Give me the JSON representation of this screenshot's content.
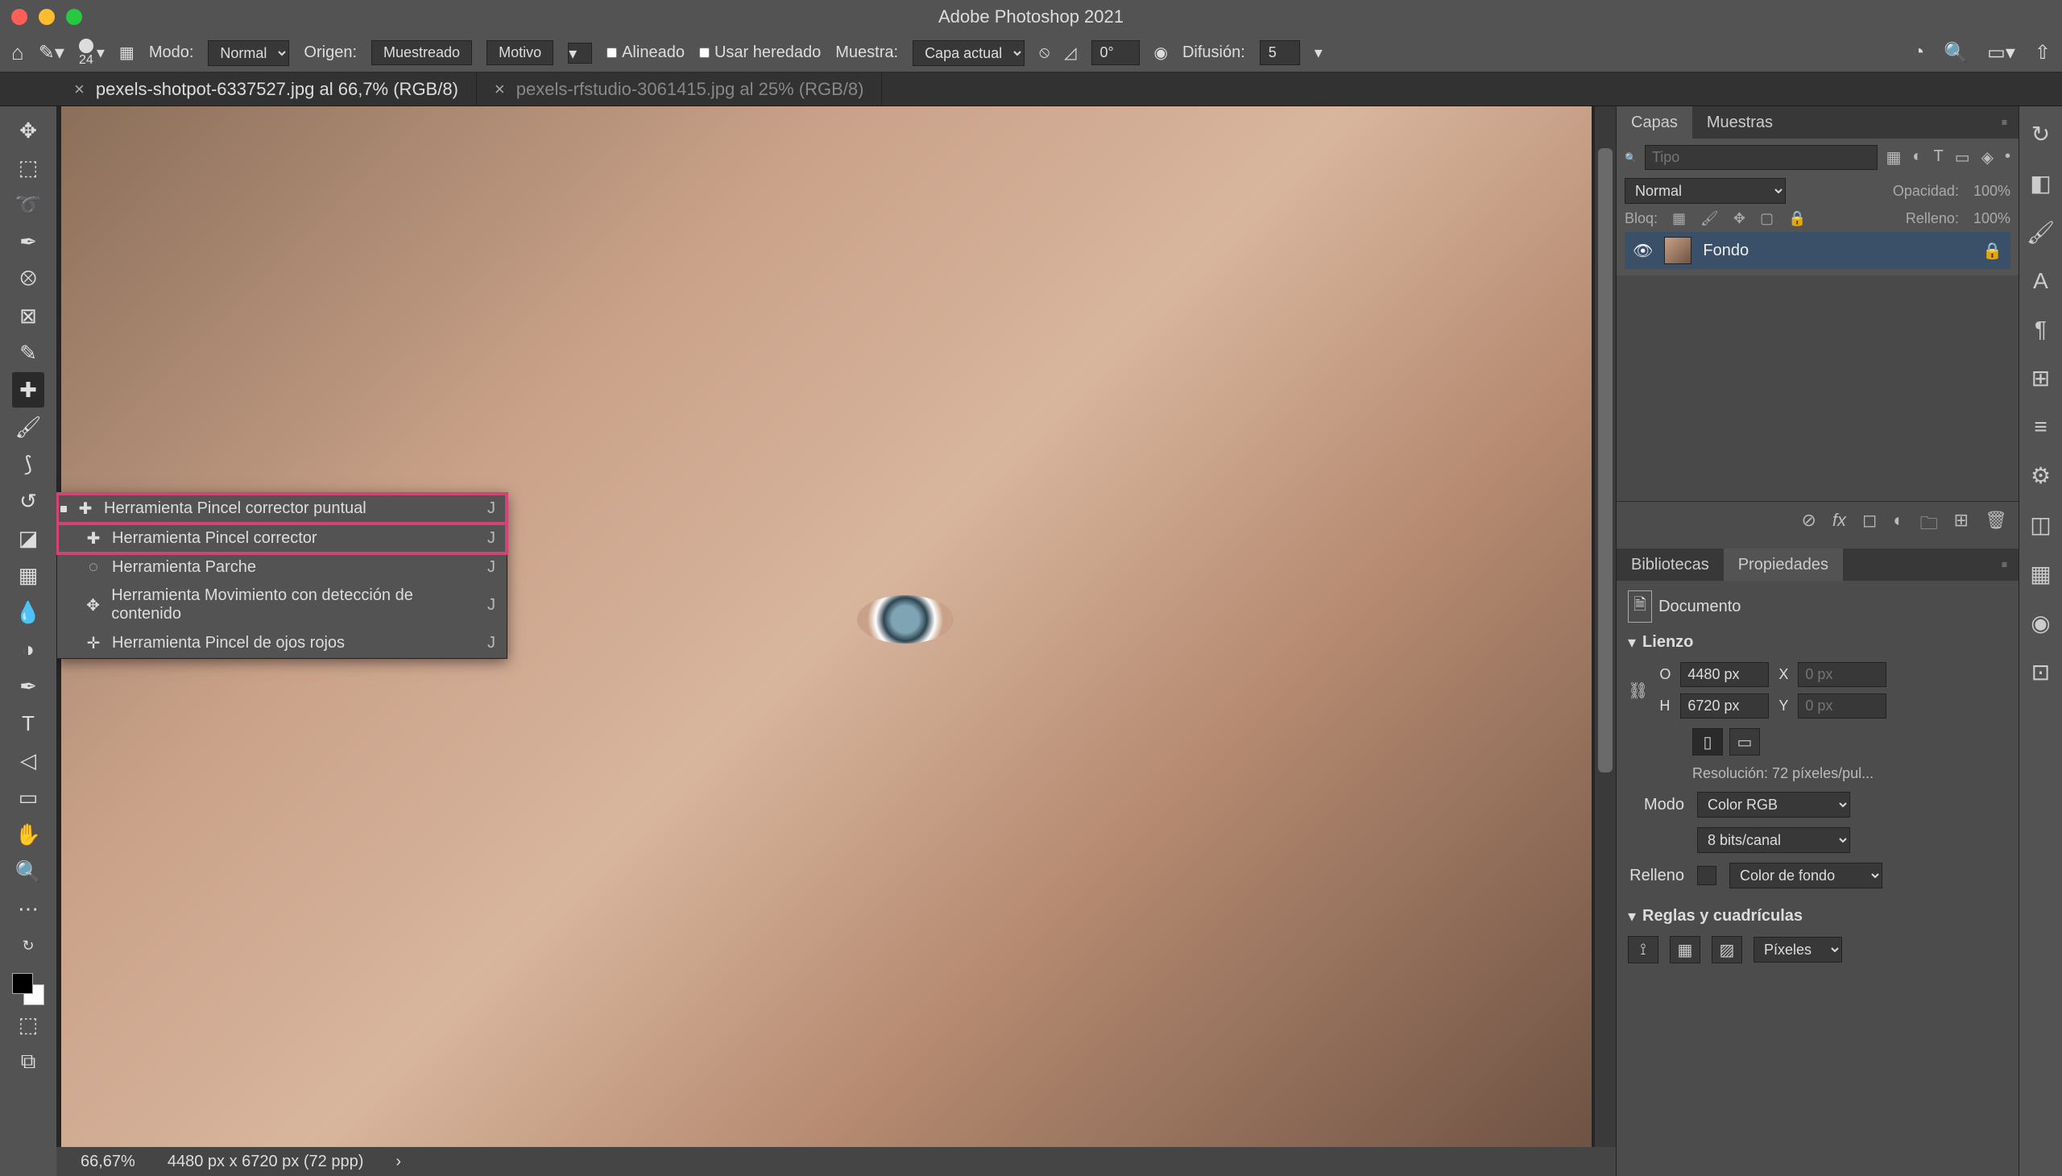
{
  "app": {
    "title": "Adobe Photoshop 2021"
  },
  "optionsbar": {
    "brush_size": "24",
    "mode_label": "Modo:",
    "mode_value": "Normal",
    "origin_label": "Origen:",
    "origin_btn1": "Muestreado",
    "origin_btn2": "Motivo",
    "chk_aligned": "Alineado",
    "chk_legacy": "Usar heredado",
    "sample_label": "Muestra:",
    "sample_value": "Capa actual",
    "angle_icon_value": "0°",
    "diffusion_label": "Difusión:",
    "diffusion_value": "5"
  },
  "tabs": [
    {
      "label": "pexels-shotpot-6337527.jpg al 66,7% (RGB/8)",
      "active": true
    },
    {
      "label": "pexels-rfstudio-3061415.jpg al 25% (RGB/8)",
      "active": false
    }
  ],
  "tool_flyout": {
    "items": [
      {
        "label": "Herramienta Pincel corrector puntual",
        "shortcut": "J",
        "selected": true,
        "highlighted": true
      },
      {
        "label": "Herramienta Pincel corrector",
        "shortcut": "J",
        "selected": false,
        "highlighted": true
      },
      {
        "label": "Herramienta Parche",
        "shortcut": "J",
        "selected": false,
        "highlighted": false
      },
      {
        "label": "Herramienta Movimiento con detección de contenido",
        "shortcut": "J",
        "selected": false,
        "highlighted": false
      },
      {
        "label": "Herramienta Pincel de ojos rojos",
        "shortcut": "J",
        "selected": false,
        "highlighted": false
      }
    ]
  },
  "status": {
    "zoom": "66,67%",
    "dims": "4480 px x 6720 px (72 ppp)"
  },
  "panels": {
    "layers": {
      "tab_layers": "Capas",
      "tab_swatches": "Muestras",
      "filter_placeholder": "Tipo",
      "blend_mode": "Normal",
      "opacity_label": "Opacidad:",
      "opacity_value": "100%",
      "lock_label": "Bloq:",
      "fill_label": "Relleno:",
      "fill_value": "100%",
      "layer_name": "Fondo"
    },
    "properties": {
      "tab_libraries": "Bibliotecas",
      "tab_props": "Propiedades",
      "doc_label": "Documento",
      "canvas_label": "Lienzo",
      "w_label": "O",
      "w_value": "4480 px",
      "h_label": "H",
      "h_value": "6720 px",
      "x_label": "X",
      "x_placeholder": "0 px",
      "y_label": "Y",
      "y_placeholder": "0 px",
      "resolution": "Resolución: 72 píxeles/pul...",
      "mode_label": "Modo",
      "mode_value": "Color RGB",
      "depth_value": "8 bits/canal",
      "fill_label": "Relleno",
      "fill_placeholder": "Color de fondo",
      "rulers_label": "Reglas y cuadrículas",
      "rulers_unit": "Píxeles"
    }
  }
}
